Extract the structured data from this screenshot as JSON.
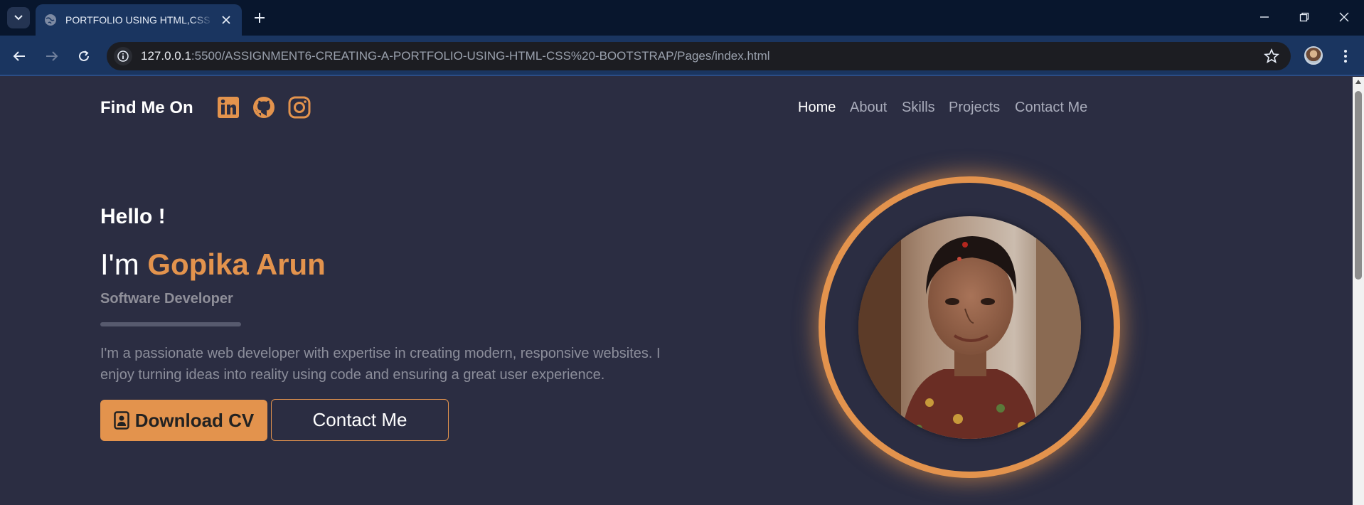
{
  "browser": {
    "tab_title": "PORTFOLIO USING HTML,CSS & BOOTSTRAP",
    "url_host": "127.0.0.1",
    "url_rest": ":5500/ASSIGNMENT6-CREATING-A-PORTFOLIO-USING-HTML-CSS%20-BOOTSTRAP/Pages/index.html"
  },
  "header": {
    "find_me": "Find Me On",
    "social_icons": [
      "linkedin-icon",
      "github-icon",
      "instagram-icon"
    ],
    "nav": [
      {
        "label": "Home",
        "active": true
      },
      {
        "label": "About",
        "active": false
      },
      {
        "label": "Skills",
        "active": false
      },
      {
        "label": "Projects",
        "active": false
      },
      {
        "label": "Contact Me",
        "active": false
      }
    ]
  },
  "hero": {
    "greeting": "Hello !",
    "intro_prefix": "I'm ",
    "name": "Gopika Arun",
    "role": "Software Developer",
    "bio": "I'm a passionate web developer with expertise in creating modern, responsive websites. I enjoy turning ideas into reality using code and ensuring a great user experience.",
    "download_cv": "Download CV",
    "contact_me": "Contact Me"
  },
  "colors": {
    "accent": "#e3934d",
    "background": "#2b2d42",
    "browser_frame": "#08162d",
    "browser_toolbar": "#1a3560"
  }
}
